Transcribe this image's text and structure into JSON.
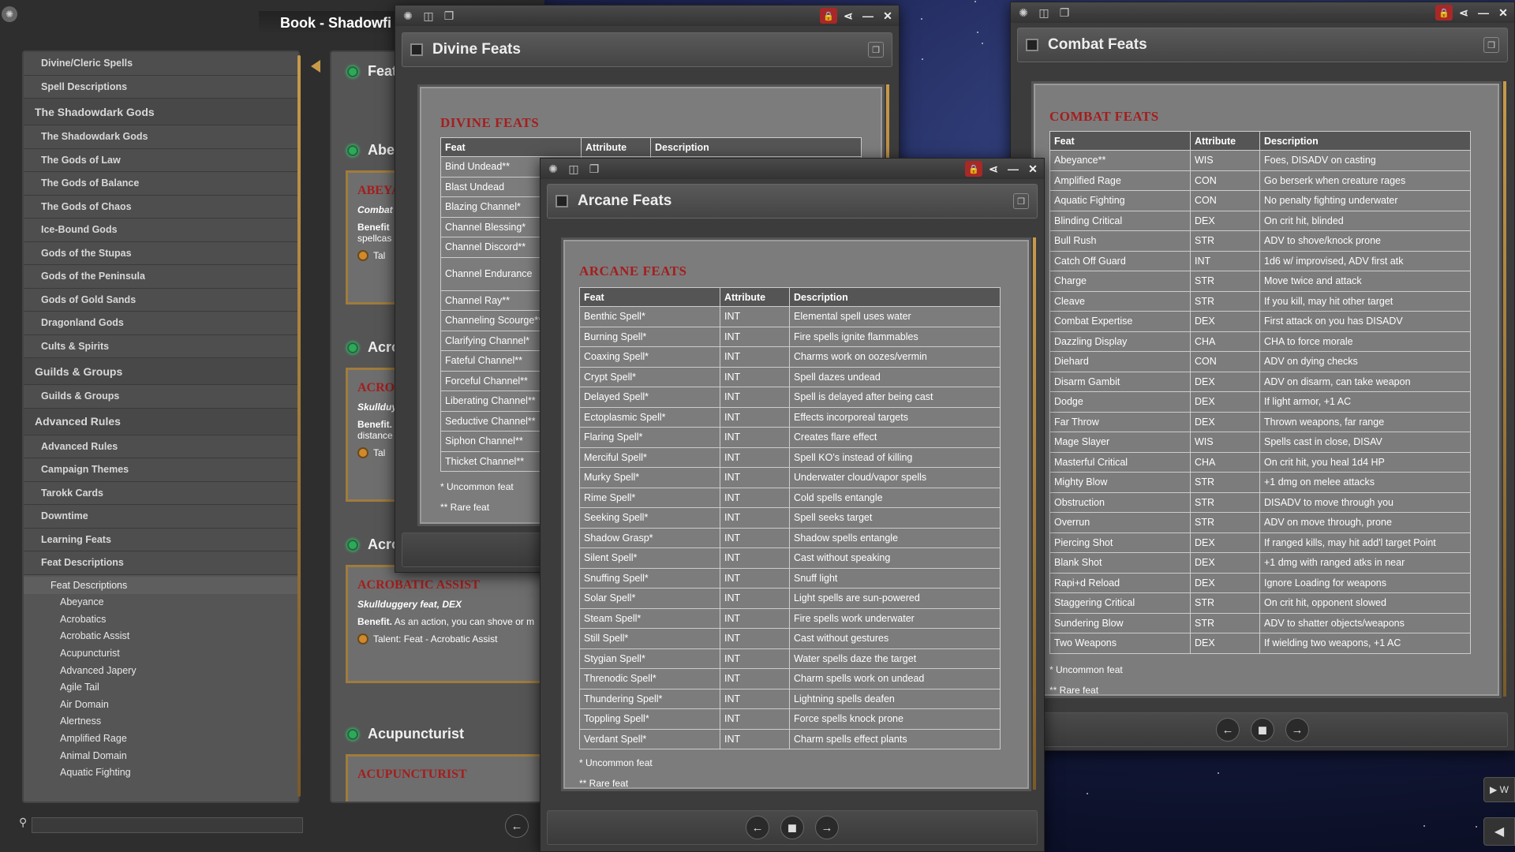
{
  "left_panel": {
    "title": "Book - Shadowfi",
    "nav": [
      {
        "label": "Divine/Cleric Spells",
        "kind": "item"
      },
      {
        "label": "Spell Descriptions",
        "kind": "item"
      },
      {
        "label": "The Shadowdark Gods",
        "kind": "group"
      },
      {
        "label": "The Shadowdark Gods",
        "kind": "item"
      },
      {
        "label": "The Gods of Law",
        "kind": "item"
      },
      {
        "label": "The Gods of Balance",
        "kind": "item"
      },
      {
        "label": "The Gods of Chaos",
        "kind": "item"
      },
      {
        "label": "Ice-Bound Gods",
        "kind": "item"
      },
      {
        "label": "Gods of the Stupas",
        "kind": "item"
      },
      {
        "label": "Gods of the Peninsula",
        "kind": "item"
      },
      {
        "label": "Gods of Gold Sands",
        "kind": "item"
      },
      {
        "label": "Dragonland Gods",
        "kind": "item"
      },
      {
        "label": "Cults & Spirits",
        "kind": "item"
      },
      {
        "label": "Guilds & Groups",
        "kind": "group"
      },
      {
        "label": "Guilds & Groups",
        "kind": "item"
      },
      {
        "label": "Advanced Rules",
        "kind": "group"
      },
      {
        "label": "Advanced Rules",
        "kind": "item"
      },
      {
        "label": "Campaign Themes",
        "kind": "item"
      },
      {
        "label": "Tarokk Cards",
        "kind": "item"
      },
      {
        "label": "Downtime",
        "kind": "item"
      },
      {
        "label": "Learning Feats",
        "kind": "item"
      },
      {
        "label": "Feat Descriptions",
        "kind": "item"
      }
    ],
    "feat_desc_header": "Feat Descriptions",
    "subitems": [
      "Abeyance",
      "Acrobatics",
      "Acrobatic Assist",
      "Acupuncturist",
      "Advanced Japery",
      "Agile Tail",
      "Air Domain",
      "Alertness",
      "Amplified Rage",
      "Animal Domain",
      "Aquatic Fighting"
    ],
    "search_placeholder": ""
  },
  "book_entries": {
    "e1": "Feat",
    "e2": "Abey",
    "e3": "Acrol",
    "e4": "Acrol",
    "e5": "Acupuncturist",
    "card1": {
      "title": "ABEYA",
      "sub": "Combat",
      "benefit": "Benefit",
      "body": "spellcas",
      "talent": "Tal"
    },
    "card2": {
      "title": "ACRO",
      "sub": "Skullduy",
      "benefit": "Benefit.",
      "body": "distance",
      "talent": "Tal"
    },
    "card3": {
      "title": "ACROBATIC ASSIST",
      "sub": "Skullduggery feat, DEX",
      "benefit": "Benefit.",
      "body": "As an action, you can shove or m",
      "talent": "Talent: Feat - Acrobatic Assist"
    },
    "card4": {
      "title": "ACUPUNCTURIST"
    }
  },
  "divine": {
    "title": "Divine Feats",
    "heading": "DIVINE FEATS",
    "headers": [
      "Feat",
      "Attribute",
      "Description"
    ],
    "rows": [
      "Bind Undead**",
      "Blast Undead",
      "Blazing Channel*",
      "Channel Blessing*",
      "Channel Discord**",
      "Channel Endurance",
      "Channel Ray**",
      "Channeling Scourge**",
      "Clarifying Channel*",
      "Fateful Channel**",
      "Forceful Channel**",
      "Liberating Channel**",
      "Seductive Channel**",
      "Siphon Channel**",
      "Thicket Channel**"
    ],
    "note1": "* Uncommon feat",
    "note2": "** Rare feat"
  },
  "arcane": {
    "title": "Arcane Feats",
    "heading": "ARCANE FEATS",
    "headers": [
      "Feat",
      "Attribute",
      "Description"
    ],
    "rows": [
      [
        "Benthic Spell*",
        "INT",
        "Elemental spell uses water"
      ],
      [
        "Burning Spell*",
        "INT",
        "Fire spells ignite flammables"
      ],
      [
        "Coaxing Spell*",
        "INT",
        "Charms work on oozes/vermin"
      ],
      [
        "Crypt Spell*",
        "INT",
        "Spell dazes undead"
      ],
      [
        "Delayed Spell*",
        "INT",
        "Spell is delayed after being cast"
      ],
      [
        "Ectoplasmic Spell*",
        "INT",
        "Effects incorporeal targets"
      ],
      [
        "Flaring Spell*",
        "INT",
        "Creates flare effect"
      ],
      [
        "Merciful Spell*",
        "INT",
        "Spell KO's instead of killing"
      ],
      [
        "Murky Spell*",
        "INT",
        "Underwater cloud/vapor spells"
      ],
      [
        "Rime Spell*",
        "INT",
        "Cold spells entangle"
      ],
      [
        "Seeking Spell*",
        "INT",
        "Spell seeks target"
      ],
      [
        "Shadow Grasp*",
        "INT",
        "Shadow spells entangle"
      ],
      [
        "Silent Spell*",
        "INT",
        "Cast without speaking"
      ],
      [
        "Snuffing Spell*",
        "INT",
        "Snuff light"
      ],
      [
        "Solar Spell*",
        "INT",
        "Light spells are sun-powered"
      ],
      [
        "Steam Spell*",
        "INT",
        "Fire spells work underwater"
      ],
      [
        "Still Spell*",
        "INT",
        "Cast without gestures"
      ],
      [
        "Stygian Spell*",
        "INT",
        "Water spells daze the target"
      ],
      [
        "Threnodic Spell*",
        "INT",
        "Charm spells work on undead"
      ],
      [
        "Thundering Spell*",
        "INT",
        "Lightning spells deafen"
      ],
      [
        "Toppling Spell*",
        "INT",
        "Force spells knock prone"
      ],
      [
        "Verdant Spell*",
        "INT",
        "Charm spells effect plants"
      ]
    ],
    "note1": "* Uncommon feat",
    "note2": "** Rare feat"
  },
  "combat": {
    "title": "Combat Feats",
    "heading": "COMBAT FEATS",
    "headers": [
      "Feat",
      "Attribute",
      "Description"
    ],
    "rows": [
      [
        "Abeyance**",
        "WIS",
        "Foes, DISADV on casting"
      ],
      [
        "Amplified Rage",
        "CON",
        "Go berserk when creature rages"
      ],
      [
        "Aquatic Fighting",
        "CON",
        "No penalty fighting underwater"
      ],
      [
        "Blinding Critical",
        "DEX",
        "On crit hit, blinded"
      ],
      [
        "Bull Rush",
        "STR",
        "ADV to shove/knock prone"
      ],
      [
        "Catch Off Guard",
        "INT",
        "1d6 w/ improvised, ADV first atk"
      ],
      [
        "Charge",
        "STR",
        "Move twice and attack"
      ],
      [
        "Cleave",
        "STR",
        "If you kill, may hit other target"
      ],
      [
        "Combat Expertise",
        "DEX",
        "First attack on you has DISADV"
      ],
      [
        "Dazzling Display",
        "CHA",
        "CHA to force morale"
      ],
      [
        "Diehard",
        "CON",
        "ADV on dying checks"
      ],
      [
        "Disarm Gambit",
        "DEX",
        "ADV on disarm, can take weapon"
      ],
      [
        "Dodge",
        "DEX",
        "If light armor, +1 AC"
      ],
      [
        "Far Throw",
        "DEX",
        "Thrown weapons, far range"
      ],
      [
        "Mage Slayer",
        "WIS",
        "Spells cast in close, DISAV"
      ],
      [
        "Masterful Critical",
        "CHA",
        "On crit hit, you heal 1d4 HP"
      ],
      [
        "Mighty Blow",
        "STR",
        "+1 dmg on melee attacks"
      ],
      [
        "Obstruction",
        "STR",
        "DISADV to move through you"
      ],
      [
        "Overrun",
        "STR",
        "ADV on move through, prone"
      ],
      [
        "Piercing Shot",
        "DEX",
        "If ranged kills, may hit add'l target Point"
      ],
      [
        "Blank Shot",
        "DEX",
        "+1 dmg with ranged atks in near"
      ],
      [
        "Rapi+d Reload",
        "DEX",
        "Ignore Loading for weapons"
      ],
      [
        "Staggering Critical",
        "STR",
        "On crit hit, opponent slowed"
      ],
      [
        "Sundering Blow",
        "STR",
        "ADV to shatter objects/weapons"
      ],
      [
        "Two Weapons",
        "DEX",
        "If wielding two weapons, +1 AC"
      ]
    ],
    "note1": "* Uncommon feat",
    "note2": "** Rare feat"
  },
  "misc": {
    "play_label": "▶ W"
  },
  "colors": {
    "accent_red": "#a51d1d",
    "lock_red": "#a82828",
    "gold": "#a07c3c",
    "gem_green": "#2fa85a"
  }
}
